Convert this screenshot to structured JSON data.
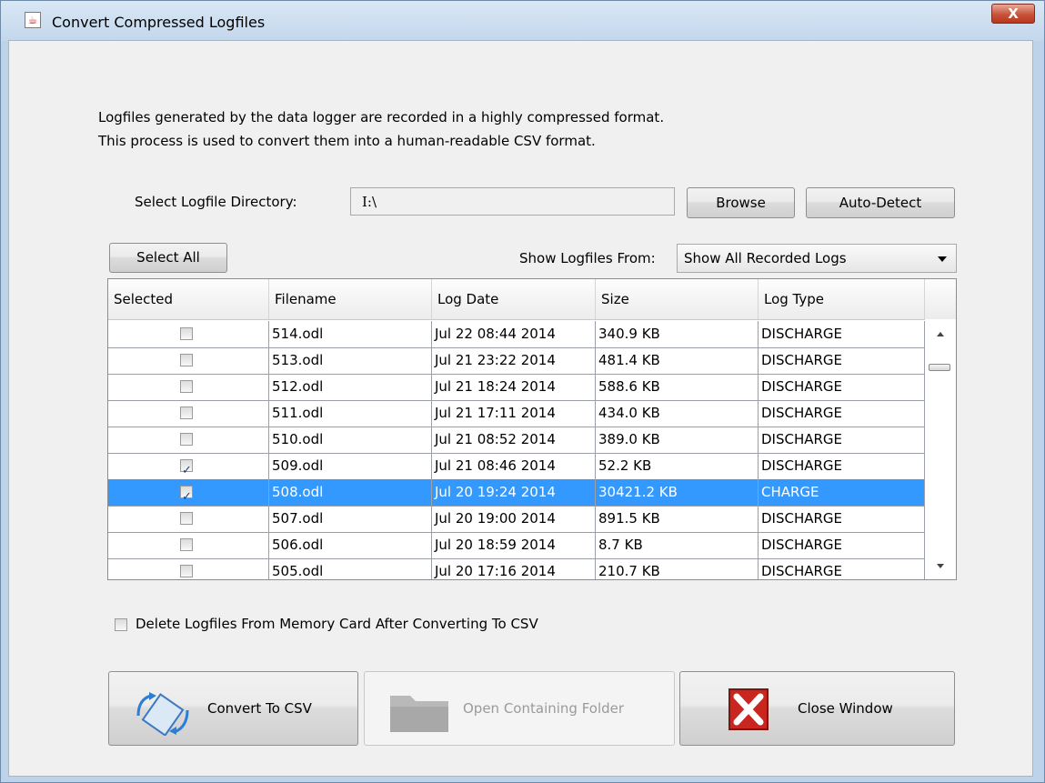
{
  "window": {
    "title": "Convert Compressed Logfiles",
    "close_glyph": "X"
  },
  "description": {
    "line1": "Logfiles generated by the data logger are recorded in a highly compressed format.",
    "line2": "This process is used to convert them into a human-readable CSV format."
  },
  "directory": {
    "label": "Select Logfile Directory:",
    "value": "I:\\",
    "browse_label": "Browse",
    "autodetect_label": "Auto-Detect"
  },
  "select_all_label": "Select All",
  "filter": {
    "label": "Show Logfiles From:",
    "selected": "Show All Recorded Logs"
  },
  "table": {
    "columns": [
      "Selected",
      "Filename",
      "Log Date",
      "Size",
      "Log Type"
    ],
    "rows": [
      {
        "selected": false,
        "filename": "514.odl",
        "date": "Jul 22 08:44 2014",
        "size": "340.9 KB",
        "type": "DISCHARGE"
      },
      {
        "selected": false,
        "filename": "513.odl",
        "date": "Jul 21 23:22 2014",
        "size": "481.4 KB",
        "type": "DISCHARGE"
      },
      {
        "selected": false,
        "filename": "512.odl",
        "date": "Jul 21 18:24 2014",
        "size": "588.6 KB",
        "type": "DISCHARGE"
      },
      {
        "selected": false,
        "filename": "511.odl",
        "date": "Jul 21 17:11 2014",
        "size": "434.0 KB",
        "type": "DISCHARGE"
      },
      {
        "selected": false,
        "filename": "510.odl",
        "date": "Jul 21 08:52 2014",
        "size": "389.0 KB",
        "type": "DISCHARGE"
      },
      {
        "selected": true,
        "filename": "509.odl",
        "date": "Jul 21 08:46 2014",
        "size": "52.2 KB",
        "type": "DISCHARGE"
      },
      {
        "selected": true,
        "filename": "508.odl",
        "date": "Jul 20 19:24 2014",
        "size": "30421.2 KB",
        "type": "CHARGE",
        "highlighted": true
      },
      {
        "selected": false,
        "filename": "507.odl",
        "date": "Jul 20 19:00 2014",
        "size": "891.5 KB",
        "type": "DISCHARGE"
      },
      {
        "selected": false,
        "filename": "506.odl",
        "date": "Jul 20 18:59 2014",
        "size": "8.7 KB",
        "type": "DISCHARGE"
      },
      {
        "selected": false,
        "filename": "505.odl",
        "date": "Jul 20 17:16 2014",
        "size": "210.7 KB",
        "type": "DISCHARGE"
      }
    ]
  },
  "delete_option": {
    "label": "Delete Logfiles From Memory Card After Converting To CSV",
    "checked": false
  },
  "actions": {
    "convert_label": "Convert To CSV",
    "open_folder_label": "Open Containing Folder",
    "close_label": "Close Window"
  },
  "colors": {
    "selection": "#3399ff",
    "close_red": "#c8261e"
  }
}
